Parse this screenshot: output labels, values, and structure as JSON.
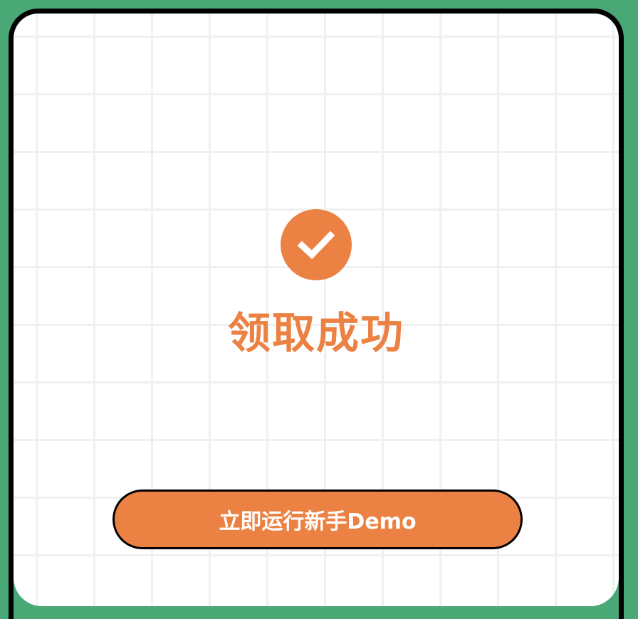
{
  "dialog": {
    "status_icon": "check-icon",
    "title": "领取成功",
    "cta_label": "立即运行新手Demo"
  },
  "colors": {
    "background": "#4aa876",
    "accent": "#eb8243",
    "card": "#ffffff",
    "border": "#000000",
    "grid": "#eef0f1"
  }
}
